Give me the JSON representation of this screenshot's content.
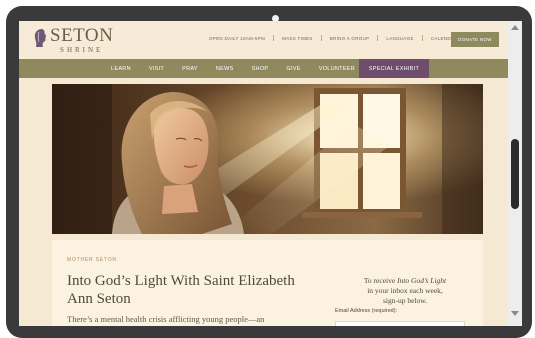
{
  "site": {
    "logo_main": "SETON",
    "logo_sub": "SHRINE"
  },
  "topbar": {
    "links": [
      "OPEN DAILY 10AM-5PM",
      "MASS TIMES",
      "BRING A GROUP",
      "LANGUAGE",
      "CALENDAR"
    ],
    "donate_label": "DONATE NOW"
  },
  "nav": {
    "items": [
      "LEARN",
      "VISIT",
      "PRAY",
      "NEWS",
      "SHOP",
      "GIVE",
      "VOLUNTEER"
    ],
    "special_label": "SPECIAL EXHIBIT"
  },
  "hero": {
    "alt": "Woman with eyes closed in sunlight by a window"
  },
  "article": {
    "eyebrow": "MOTHER SETON",
    "title": "Into God’s Light With Saint Elizabeth Ann Seton",
    "excerpt": "There’s a mental health crisis afflicting young people—an"
  },
  "signup": {
    "line1_prefix": "To receive ",
    "line1_em": "Into God’s Light",
    "line2": "in your inbox each week,",
    "line3": "sign-up below.",
    "email_label": "Email Address (required):",
    "email_value": ""
  },
  "colors": {
    "nav_bg": "#8e8a5e",
    "special_bg": "#6d4d6b",
    "page_bg": "#f6e9d3",
    "brand_text": "#6b5e49"
  },
  "icons": {
    "logo": "seton-profile-icon",
    "scroll_up": "arrow-up-icon",
    "scroll_down": "arrow-down-icon"
  }
}
